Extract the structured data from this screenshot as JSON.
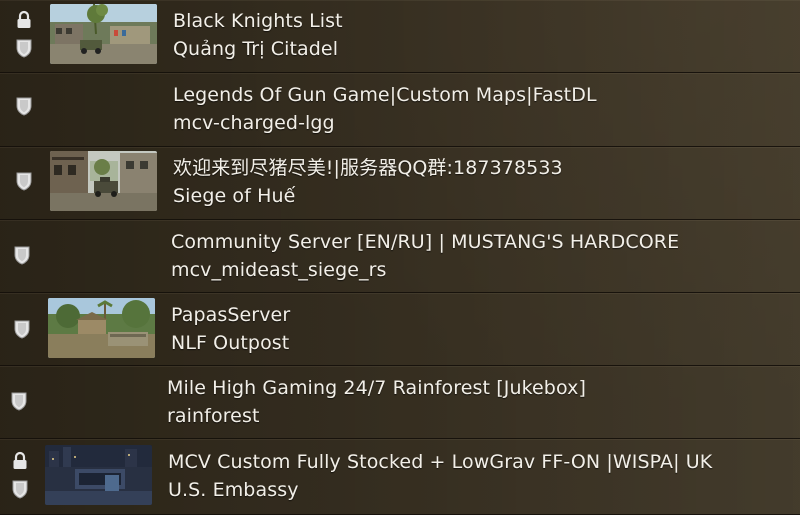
{
  "servers": [
    {
      "name": "Black Knights List",
      "map": "Quảng Trị Citadel",
      "locked": true,
      "icon": "shield-icon",
      "thumbnail": "map-thumbnail-jungle-village"
    },
    {
      "name": "Legends Of Gun Game|Custom Maps|FastDL",
      "map": "mcv-charged-lgg",
      "locked": false,
      "icon": "shield-icon",
      "thumbnail": null
    },
    {
      "name": "欢迎来到尽猪尽美!|服务器QQ群:187378533",
      "map": "Siege of Huế",
      "locked": false,
      "icon": "shield-icon",
      "thumbnail": "map-thumbnail-street"
    },
    {
      "name": "Community Server [EN/RU] | MUSTANG'S HARDCORE",
      "map": "mcv_mideast_siege_rs",
      "locked": false,
      "icon": "shield-icon",
      "thumbnail": null
    },
    {
      "name": "PapasServer",
      "map": "NLF Outpost",
      "locked": false,
      "icon": "shield-icon",
      "thumbnail": "map-thumbnail-outpost"
    },
    {
      "name": "Mile High Gaming 24/7 Rainforest [Jukebox]",
      "map": "rainforest",
      "locked": false,
      "icon": "shield-icon",
      "thumbnail": null
    },
    {
      "name": "MCV Custom Fully Stocked + LowGrav FF-ON |WISPA| UK",
      "map": "U.S. Embassy",
      "locked": true,
      "icon": "shield-icon",
      "thumbnail": "map-thumbnail-embassy-night"
    }
  ],
  "colors": {
    "text": "#f2efe8",
    "row_dark": "#2a2418",
    "row_light": "#4a4232",
    "icon": "#e6e6e6"
  }
}
